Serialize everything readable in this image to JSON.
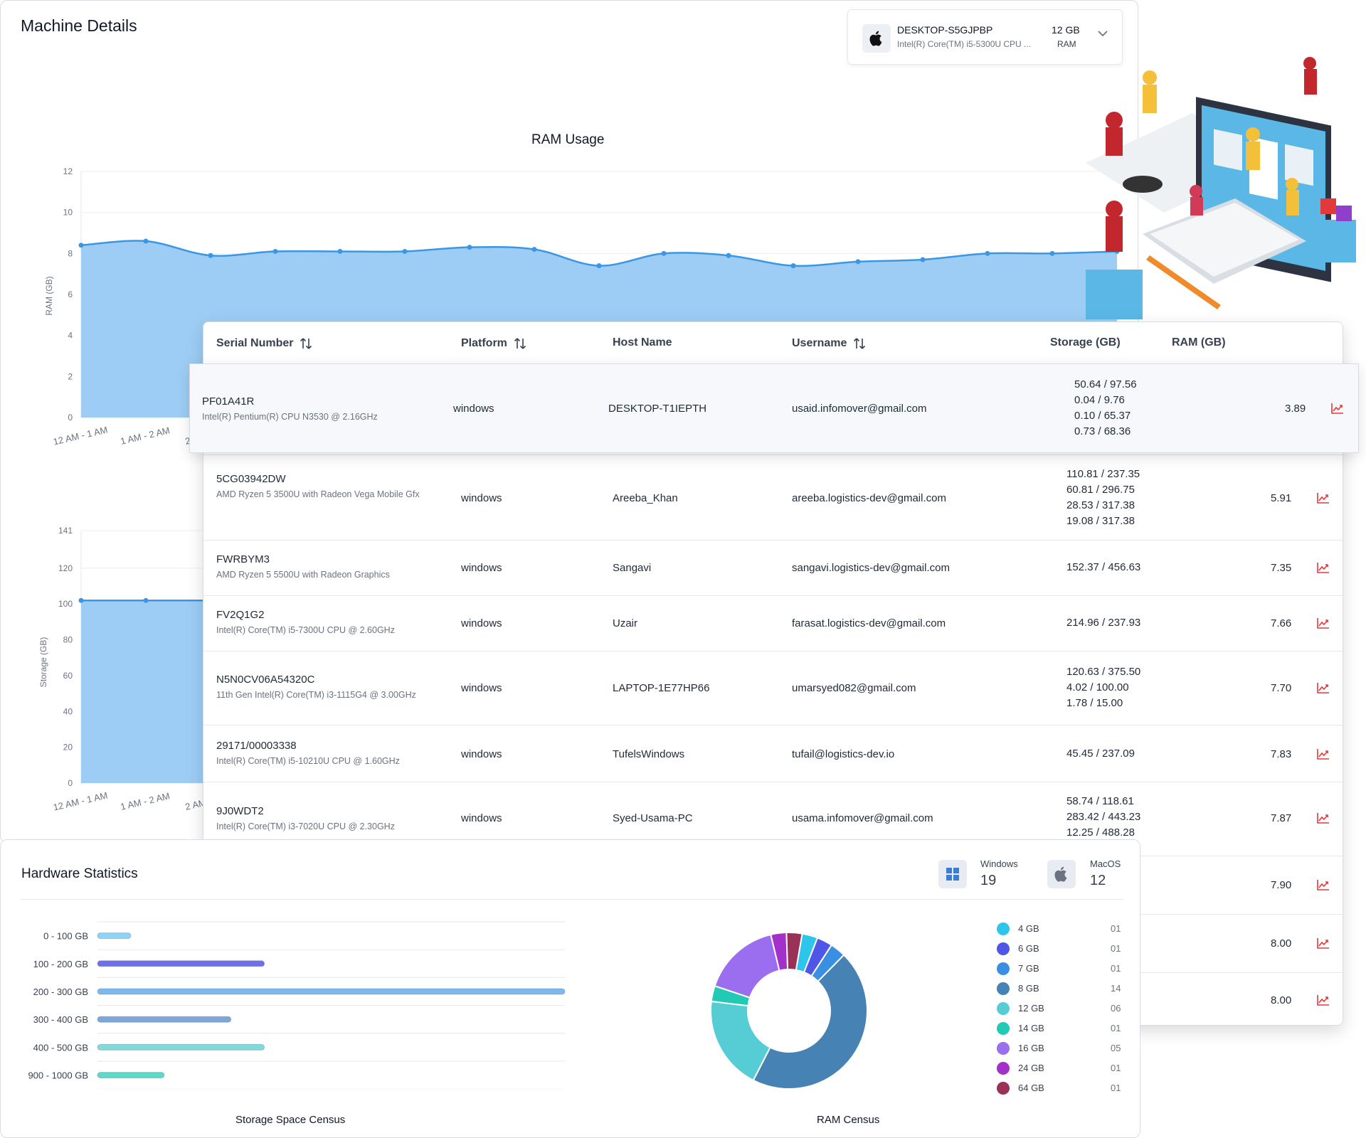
{
  "machine_details": {
    "title": "Machine Details",
    "selector": {
      "host": "DESKTOP-S5GJPBP",
      "cpu": "Intel(R) Core(TM) i5-5300U CPU ...",
      "ram_value": "12 GB",
      "ram_label": "RAM"
    }
  },
  "ram_chart": {
    "chart_data": {
      "type": "area",
      "title": "RAM Usage",
      "ylabel": "RAM (GB)",
      "ylim": [
        0,
        12
      ],
      "yticks": [
        0,
        2,
        4,
        6,
        8,
        10,
        12
      ],
      "categories": [
        "12 AM - 1 AM",
        "1 AM - 2 AM",
        "2 AM - 3 AM"
      ],
      "values": [
        8.4,
        8.6,
        7.9,
        8.1,
        8.1,
        8.1,
        8.3,
        8.2,
        7.4,
        8.0,
        7.9,
        7.4,
        7.6,
        7.7,
        8.0,
        8.0,
        8.1
      ],
      "color": "#3b97e3",
      "fill": "#9dcdf4"
    }
  },
  "storage_chart": {
    "chart_data": {
      "type": "area",
      "ylabel": "Storage (GB)",
      "ylim": [
        0,
        141
      ],
      "yticks": [
        0,
        20,
        40,
        60,
        80,
        100,
        120,
        141
      ],
      "categories": [
        "12 AM - 1 AM",
        "1 AM - 2 AM",
        "2 AM - 3 AM"
      ],
      "values": [
        102,
        102,
        102
      ],
      "color": "#3b97e3",
      "fill": "#9dcdf4"
    }
  },
  "table": {
    "headers": {
      "serial": "Serial Number",
      "platform": "Platform",
      "host": "Host Name",
      "username": "Username",
      "storage": "Storage (GB)",
      "ram": "RAM (GB)"
    },
    "rows": [
      {
        "serial": "PF01A41R",
        "cpu": "Intel(R) Pentium(R) CPU N3530 @ 2.16GHz",
        "platform": "windows",
        "host": "DESKTOP-T1IEPTH",
        "username": "usaid.infomover@gmail.com",
        "storage": [
          "50.64 / 97.56",
          "0.04 / 9.76",
          "0.10 / 65.37",
          "0.73 / 68.36"
        ],
        "ram": "3.89"
      },
      {
        "serial": "5CG03942DW",
        "cpu": "AMD Ryzen 5 3500U with Radeon Vega Mobile Gfx",
        "platform": "windows",
        "host": "Areeba_Khan",
        "username": "areeba.logistics-dev@gmail.com",
        "storage": [
          "110.81 / 237.35",
          "60.81 / 296.75",
          "28.53 / 317.38",
          "19.08 / 317.38"
        ],
        "ram": "5.91"
      },
      {
        "serial": "FWRBYM3",
        "cpu": "AMD Ryzen 5 5500U with Radeon Graphics",
        "platform": "windows",
        "host": "Sangavi",
        "username": "sangavi.logistics-dev@gmail.com",
        "storage": [
          "152.37 / 456.63"
        ],
        "ram": "7.35"
      },
      {
        "serial": "FV2Q1G2",
        "cpu": "Intel(R) Core(TM) i5-7300U CPU @ 2.60GHz",
        "platform": "windows",
        "host": "Uzair",
        "username": "farasat.logistics-dev@gmail.com",
        "storage": [
          "214.96 / 237.93"
        ],
        "ram": "7.66"
      },
      {
        "serial": "N5N0CV06A54320C",
        "cpu": "11th Gen Intel(R) Core(TM) i3-1115G4 @ 3.00GHz",
        "platform": "windows",
        "host": "LAPTOP-1E77HP66",
        "username": "umarsyed082@gmail.com",
        "storage": [
          "120.63 / 375.50",
          "4.02 / 100.00",
          "1.78 / 15.00"
        ],
        "ram": "7.70"
      },
      {
        "serial": "29171/00003338",
        "cpu": "Intel(R) Core(TM) i5-10210U CPU @ 1.60GHz",
        "platform": "windows",
        "host": "TufelsWindows",
        "username": "tufail@logistics-dev.io",
        "storage": [
          "45.45 / 237.09"
        ],
        "ram": "7.83"
      },
      {
        "serial": "9J0WDT2",
        "cpu": "Intel(R) Core(TM) i3-7020U CPU @ 2.30GHz",
        "platform": "windows",
        "host": "Syed-Usama-PC",
        "username": "usama.infomover@gmail.com",
        "storage": [
          "58.74 / 118.61",
          "283.42 / 443.23",
          "12.25 / 488.28"
        ],
        "ram": "7.87"
      },
      {
        "ram": "7.90"
      },
      {
        "ram": "8.00"
      },
      {
        "ram": "8.00"
      }
    ]
  },
  "hardware": {
    "title": "Hardware Statistics",
    "os": [
      {
        "name": "Windows",
        "count": "19"
      },
      {
        "name": "MacOS",
        "count": "12"
      }
    ],
    "storage_census": {
      "label": "Storage Space Census",
      "chart_data": {
        "type": "bar",
        "orientation": "horizontal",
        "categories": [
          "0 - 100 GB",
          "100 - 200 GB",
          "200 - 300 GB",
          "300 - 400 GB",
          "400 - 500 GB",
          "900 - 1000 GB"
        ],
        "values": [
          1,
          5,
          14,
          4,
          5,
          2
        ],
        "colors": [
          "#8fd3f5",
          "#6f6fe8",
          "#7db8ec",
          "#7ea6d6",
          "#7fdcd6",
          "#5fd8c6"
        ]
      }
    },
    "ram_census": {
      "label": "RAM Census",
      "chart_data": {
        "type": "pie",
        "categories": [
          "4 GB",
          "6 GB",
          "7 GB",
          "8 GB",
          "12 GB",
          "14 GB",
          "16 GB",
          "24 GB",
          "64 GB"
        ],
        "values": [
          1,
          1,
          1,
          14,
          6,
          1,
          5,
          1,
          1
        ],
        "labels": [
          "01",
          "01",
          "01",
          "14",
          "06",
          "01",
          "05",
          "01",
          "01"
        ],
        "colors": [
          "#2ec5ea",
          "#4f55e6",
          "#3b8fe3",
          "#4682b4",
          "#56cdd4",
          "#22c9b5",
          "#9b6ef0",
          "#a330c9",
          "#9a3258"
        ]
      }
    }
  }
}
